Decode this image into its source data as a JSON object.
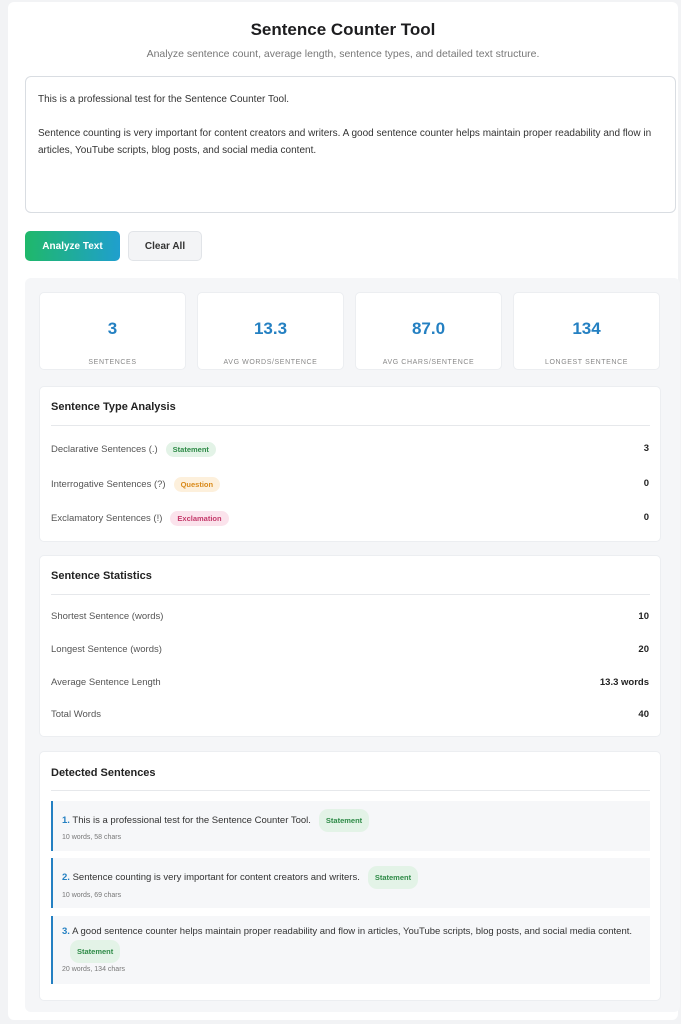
{
  "header": {
    "title": "Sentence Counter Tool",
    "subtitle": "Analyze sentence count, average length, sentence types, and detailed text structure."
  },
  "input": {
    "value": "This is a professional test for the Sentence Counter Tool.\n\nSentence counting is very important for content creators and writers. A good sentence counter helps maintain proper readability and flow in articles, YouTube scripts, blog posts, and social media content."
  },
  "buttons": {
    "analyze": "Analyze Text",
    "clear": "Clear All"
  },
  "stats": [
    {
      "value": "3",
      "label": "SENTENCES"
    },
    {
      "value": "13.3",
      "label": "AVG WORDS/SENTENCE"
    },
    {
      "value": "87.0",
      "label": "AVG CHARS/SENTENCE"
    },
    {
      "value": "134",
      "label": "LONGEST SENTENCE"
    }
  ],
  "types": {
    "title": "Sentence Type Analysis",
    "rows": [
      {
        "label": "Declarative Sentences (.)",
        "badge": "Statement",
        "value": "3",
        "color": "#2e8b47"
      },
      {
        "label": "Interrogative Sentences (?)",
        "badge": "Question",
        "value": "0",
        "color": "#d98a1a"
      },
      {
        "label": "Exclamatory Sentences (!)",
        "badge": "Exclamation",
        "value": "0",
        "color": "#c4396a"
      }
    ]
  },
  "statistics": {
    "title": "Sentence Statistics",
    "rows": [
      {
        "label": "Shortest Sentence (words)",
        "value": "10"
      },
      {
        "label": "Longest Sentence (words)",
        "value": "20"
      },
      {
        "label": "Average Sentence Length",
        "value": "13.3 words"
      },
      {
        "label": "Total Words",
        "value": "40"
      }
    ]
  },
  "detected": {
    "title": "Detected Sentences",
    "items": [
      {
        "num": "1.",
        "text": "This is a professional test for the Sentence Counter Tool.",
        "badge": "Statement",
        "meta": "10 words, 58 chars"
      },
      {
        "num": "2.",
        "text": "Sentence counting is very important for content creators and writers.",
        "badge": "Statement",
        "meta": "10 words, 69 chars"
      },
      {
        "num": "3.",
        "text": "A good sentence counter helps maintain proper readability and flow in articles, YouTube scripts, blog posts, and social media content.",
        "badge": "Statement",
        "meta": "20 words, 134 chars"
      }
    ]
  },
  "colors": {
    "accent": "#2480c2",
    "gradient_start": "#1fb86a",
    "gradient_end": "#1f9fce"
  }
}
